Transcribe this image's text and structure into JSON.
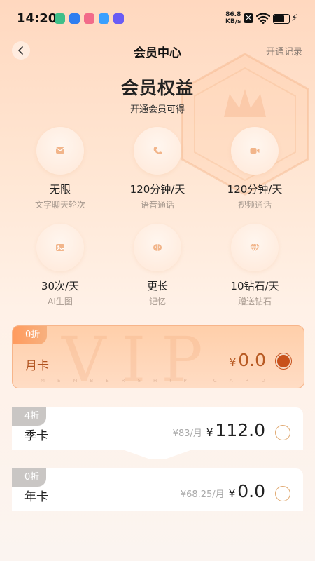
{
  "status_bar": {
    "time": "14:20",
    "network_speed": "86.8",
    "network_unit": "KB/s",
    "app_icon_colors": [
      "#3fbf8a",
      "#2f7ef0",
      "#f26b8a",
      "#3aa0ff",
      "#6a5cf5"
    ]
  },
  "header": {
    "title": "会员中心",
    "records_link": "开通记录"
  },
  "hero": {
    "title": "会员权益",
    "subtitle": "开通会员可得"
  },
  "benefits": [
    {
      "value": "无限",
      "label": "文字聊天轮次",
      "icon": "message-icon"
    },
    {
      "value": "120分钟/天",
      "label": "语音通话",
      "icon": "phone-icon"
    },
    {
      "value": "120分钟/天",
      "label": "视频通话",
      "icon": "video-icon"
    },
    {
      "value": "30次/天",
      "label": "AI生图",
      "icon": "image-icon"
    },
    {
      "value": "更长",
      "label": "记忆",
      "icon": "memory-icon"
    },
    {
      "value": "10钻石/天",
      "label": "赠送钻石",
      "icon": "diamond-icon"
    }
  ],
  "plans": [
    {
      "badge": "0折",
      "name": "月卡",
      "per_month": "",
      "currency": "¥",
      "price": "0.0",
      "selected": true,
      "watermark": "VIP",
      "watermark_sub": "MEMBERSHIP CARD"
    },
    {
      "badge": "4折",
      "name": "季卡",
      "per_month": "¥83/月",
      "currency": "¥",
      "price": "112.0",
      "selected": false
    },
    {
      "badge": "0折",
      "name": "年卡",
      "per_month": "¥68.25/月",
      "currency": "¥",
      "price": "0.0",
      "selected": false
    }
  ],
  "colors": {
    "accent": "#c8511b",
    "badge_hot": "#ff9b5e",
    "badge_gray": "#c9c6c4"
  }
}
